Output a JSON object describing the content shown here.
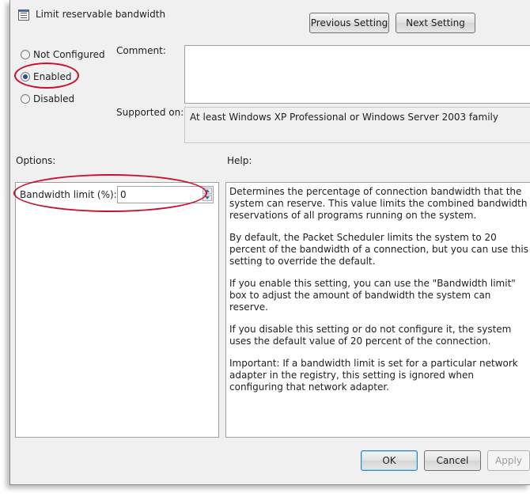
{
  "window": {
    "title": "Limit reservable bandwidth"
  },
  "nav": {
    "previous": "Previous Setting",
    "next": "Next Setting"
  },
  "state": {
    "not_configured": "Not Configured",
    "enabled": "Enabled",
    "disabled": "Disabled",
    "selected": "Enabled"
  },
  "comment": {
    "label": "Comment:",
    "value": ""
  },
  "supported": {
    "label": "Supported on:",
    "value": "At least Windows XP Professional or Windows Server 2003 family"
  },
  "options": {
    "label": "Options:",
    "bandwidth_label": "Bandwidth limit (%):",
    "bandwidth_value": "0"
  },
  "help": {
    "label": "Help:",
    "paragraphs": [
      "Determines the percentage of connection bandwidth that the system can reserve. This value limits the combined bandwidth reservations of all programs running on the system.",
      "By default, the Packet Scheduler limits the system to 20 percent of the bandwidth of a connection, but you can use this setting to override the default.",
      "If you enable this setting, you can use the \"Bandwidth limit\" box to adjust the amount of bandwidth the system can reserve.",
      "If you disable this setting or do not configure it, the system uses the default value of 20 percent of the connection.",
      "Important: If a bandwidth limit is set for a particular network adapter in the registry, this setting is ignored when configuring that network adapter."
    ]
  },
  "buttons": {
    "ok": "OK",
    "cancel": "Cancel",
    "apply": "Apply"
  },
  "colors": {
    "highlight": "#c8102e",
    "default_button_border": "#3c7fb1"
  }
}
